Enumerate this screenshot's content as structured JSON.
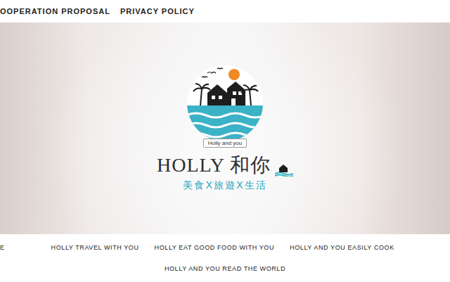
{
  "top_bar": {
    "links": [
      "OOPERATION PROPOSAL",
      "PRIVACY POLICY"
    ]
  },
  "hero": {
    "badge": "Holly and you",
    "title": "HOLLY 和你",
    "tagline": "美食X旅遊X生活"
  },
  "nav": {
    "rows": [
      [
        "E",
        "HOLLY TRAVEL WITH YOU",
        "HOLLY EAT GOOD FOOD WITH YOU",
        "HOLLY AND YOU EASILY COOK"
      ],
      [
        "HOLLY AND YOU READ THE WORLD"
      ]
    ]
  }
}
